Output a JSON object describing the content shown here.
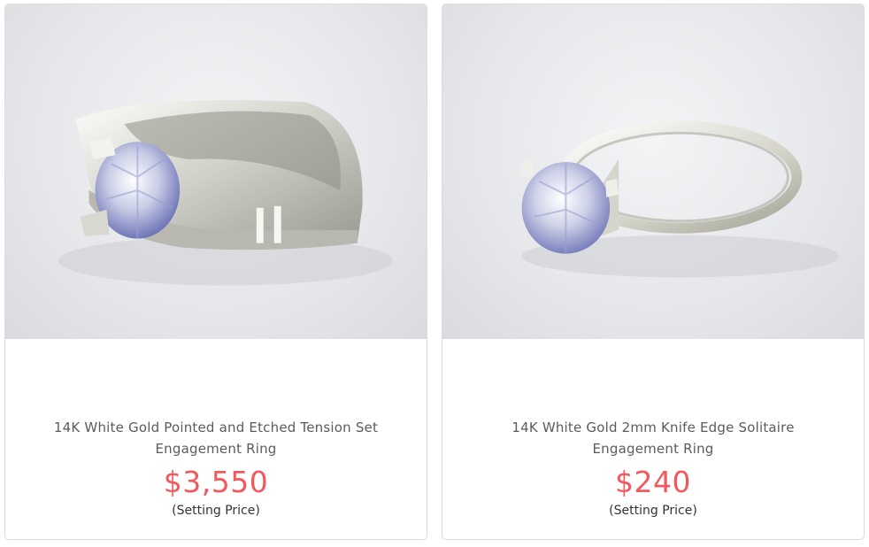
{
  "products": [
    {
      "image_icon": "tension-set-ring-image",
      "title": "14K White Gold Pointed and Etched Tension Set Engagement Ring",
      "price": "$3,550",
      "price_note": "(Setting Price)"
    },
    {
      "image_icon": "solitaire-ring-image",
      "title": "14K White Gold 2mm Knife Edge Solitaire Engagement Ring",
      "price": "$240",
      "price_note": "(Setting Price)"
    }
  ],
  "colors": {
    "price": "#f0595d",
    "title": "#5b5b5b",
    "card_border": "#dcdcdc",
    "photo_bg": "#e6e7ea"
  }
}
